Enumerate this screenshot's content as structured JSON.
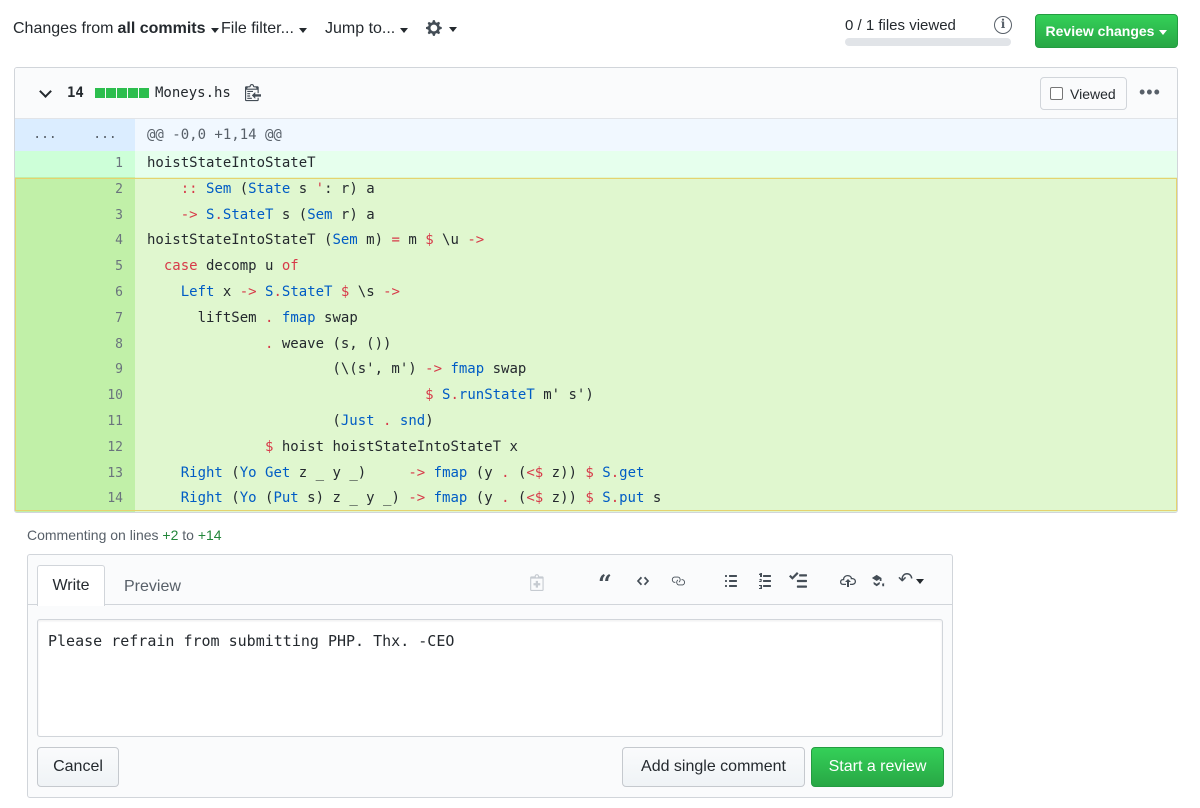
{
  "toolbar": {
    "changes_prefix": "Changes from",
    "changes_value": "all commits",
    "file_filter": "File filter...",
    "jump_to": "Jump to...",
    "gear_icon": "gear-icon",
    "files_viewed": "0 / 1 files viewed",
    "files_viewed_progress": 0,
    "review_changes": "Review changes"
  },
  "file": {
    "count": "14",
    "name": "Moneys.hs",
    "viewed_label": "Viewed",
    "hunk_gutter": "...",
    "hunk_header": "@@ -0,0 +1,14 @@",
    "lines": [
      {
        "n": "1",
        "text": "hoistStateIntoStateT"
      },
      {
        "n": "2",
        "text": "    :: Sem (State s ': r) a"
      },
      {
        "n": "3",
        "text": "    -> S.StateT s (Sem r) a"
      },
      {
        "n": "4",
        "text": "hoistStateIntoStateT (Sem m) = m $ \\u ->"
      },
      {
        "n": "5",
        "text": "  case decomp u of"
      },
      {
        "n": "6",
        "text": "    Left x -> S.StateT $ \\s ->"
      },
      {
        "n": "7",
        "text": "      liftSem . fmap swap"
      },
      {
        "n": "8",
        "text": "              . weave (s, ())"
      },
      {
        "n": "9",
        "text": "                      (\\(s', m') -> fmap swap"
      },
      {
        "n": "10",
        "text": "                                 $ S.runStateT m' s')"
      },
      {
        "n": "11",
        "text": "                      (Just . snd)"
      },
      {
        "n": "12",
        "text": "              $ hoist hoistStateIntoStateT x"
      },
      {
        "n": "13",
        "text": "    Right (Yo Get z _ y _)     -> fmap (y . (<$ z)) $ S.get"
      },
      {
        "n": "14",
        "text": "    Right (Yo (Put s) z _ y _) -> fmap (y . (<$ z)) $ S.put s"
      }
    ]
  },
  "comment": {
    "commenting_prefix": "Commenting on lines",
    "from_line": "+2",
    "to_word": "to",
    "to_line": "+14",
    "tab_write": "Write",
    "tab_preview": "Preview",
    "body": "Please refrain from submitting PHP. Thx. -CEO",
    "cancel": "Cancel",
    "add_single": "Add single comment",
    "start_review": "Start a review"
  },
  "colors": {
    "accent_green": "#28a745",
    "added_line": "#e6ffed",
    "selected_line": "#e0f7cf",
    "hunk_bg": "#f1f8ff"
  }
}
